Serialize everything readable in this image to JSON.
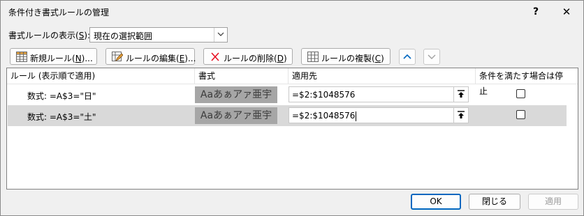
{
  "window": {
    "title": "条件付き書式ルールの管理",
    "help_label": "?",
    "close_label": "✕"
  },
  "show_rules": {
    "label_prefix": "書式ルールの表示(",
    "label_key": "S",
    "label_suffix": "):",
    "selected": "現在の選択範囲"
  },
  "toolbar": {
    "new_rule": {
      "text": "新規ルール(",
      "key": "N",
      "suffix": ")...",
      "icon": "new-rule-grid-icon"
    },
    "edit_rule": {
      "text": "ルールの編集(",
      "key": "E",
      "suffix": ")...",
      "icon": "edit-rule-icon"
    },
    "delete_rule": {
      "text": "ルールの削除(",
      "key": "D",
      "suffix": ")",
      "icon": "delete-x-icon"
    },
    "duplicate_rule": {
      "text": "ルールの複製(",
      "key": "C",
      "suffix": ")",
      "icon": "duplicate-grid-icon"
    },
    "move_up_icon": "chevron-up-icon",
    "move_down_icon": "chevron-down-icon"
  },
  "columns": {
    "rule": "ルール (表示順で適用)",
    "format": "書式",
    "applies_to": "適用先",
    "stop_if_true": "条件を満たす場合は停止"
  },
  "rules": [
    {
      "condition": "数式: =A$3=\"日\"",
      "format_preview": "Aaあぁアァ亜宇",
      "applies_to": "=$2:$1048576",
      "stop_if_true": false,
      "selected": false
    },
    {
      "condition": "数式: =A$3=\"土\"",
      "format_preview": "Aaあぁアァ亜宇",
      "applies_to": "=$2:$1048576",
      "stop_if_true": false,
      "selected": true
    }
  ],
  "buttons": {
    "ok": "OK",
    "close": "閉じる",
    "apply": "適用"
  },
  "colors": {
    "accent": "#0067c0",
    "selected_row": "#d9d9d9",
    "format_preview_bg": "#a6a6a6",
    "delete_icon": "#e81123",
    "arrow_icon": "#0067c0"
  }
}
